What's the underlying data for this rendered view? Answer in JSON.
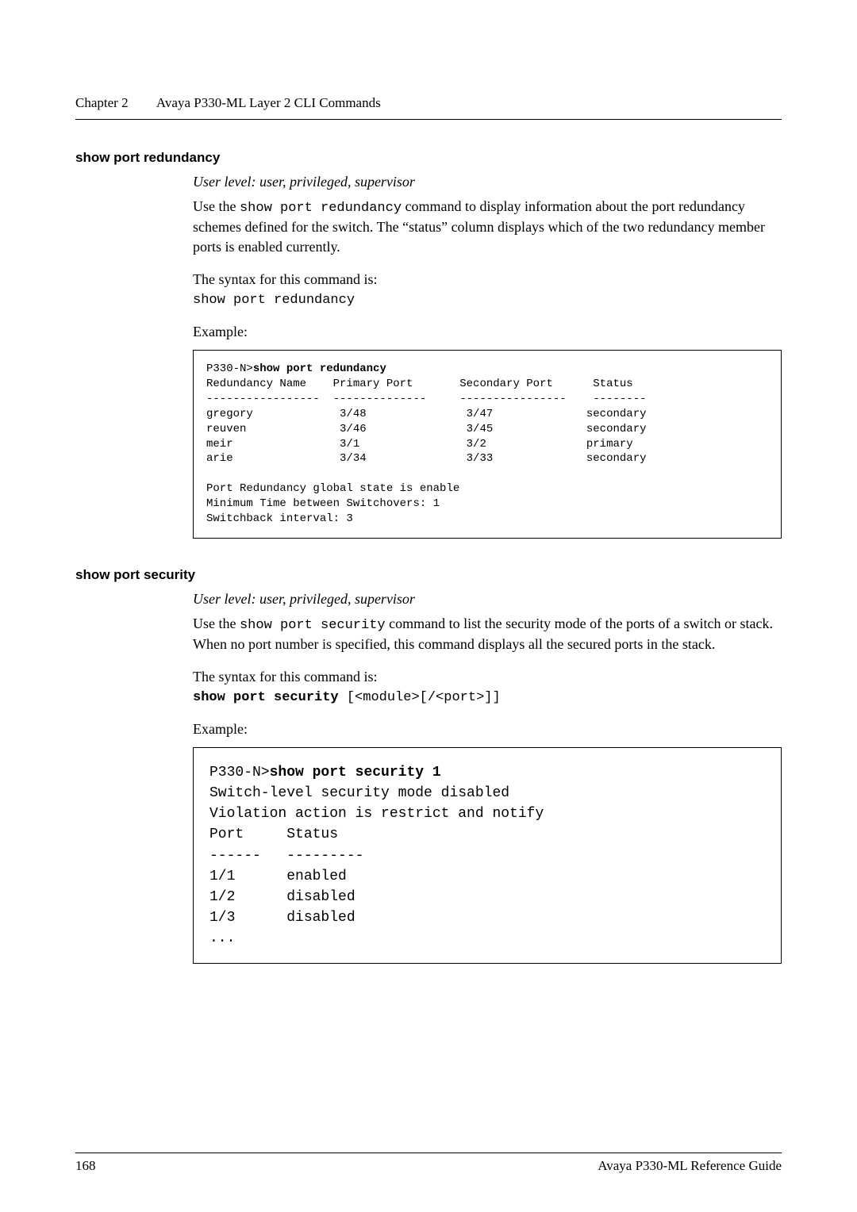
{
  "header": {
    "chapter_label": "Chapter 2",
    "chapter_title": "Avaya P330-ML Layer 2 CLI Commands"
  },
  "section1": {
    "heading": "show port redundancy",
    "user_level": "User level: user, privileged, supervisor",
    "intro_before_code": "Use the ",
    "intro_code": "show port redundancy",
    "intro_after_code": " command to display information about the port redundancy schemes defined for the switch. The “status” column displays which of the two redundancy member ports is enabled currently.",
    "syntax_label": "The syntax for this command is:",
    "syntax_cmd": "show port redundancy",
    "example_label": "Example:",
    "output": "P330-N>show port redundancy\nRedundancy Name    Primary Port       Secondary Port      Status\n-----------------  --------------     ----------------    --------\ngregory             3/48               3/47              secondary\nreuven              3/46               3/45              secondary\nmeir                3/1                3/2               primary\narie                3/34               3/33              secondary\n\nPort Redundancy global state is enable\nMinimum Time between Switchovers: 1\nSwitchback interval: 3"
  },
  "section2": {
    "heading": "show port security",
    "user_level": "User level: user, privileged, supervisor",
    "intro_before_code": "Use the ",
    "intro_code": "show port security",
    "intro_after_code": " command to list the security mode of the ports of a switch or stack. When no port number is specified, this command displays all the secured ports in the stack.",
    "syntax_label": "The syntax for this command is:",
    "syntax_cmd_bold": "show port security",
    "syntax_cmd_args": " [<module>[/<port>]]",
    "example_label": "Example:",
    "output": "P330-N>show port security 1\nSwitch-level security mode disabled\nViolation action is restrict and notify\nPort     Status\n------   ---------\n1/1      enabled\n1/2      disabled\n1/3      disabled\n..."
  },
  "footer": {
    "page_number": "168",
    "doc_title": "Avaya P330-ML Reference Guide"
  }
}
